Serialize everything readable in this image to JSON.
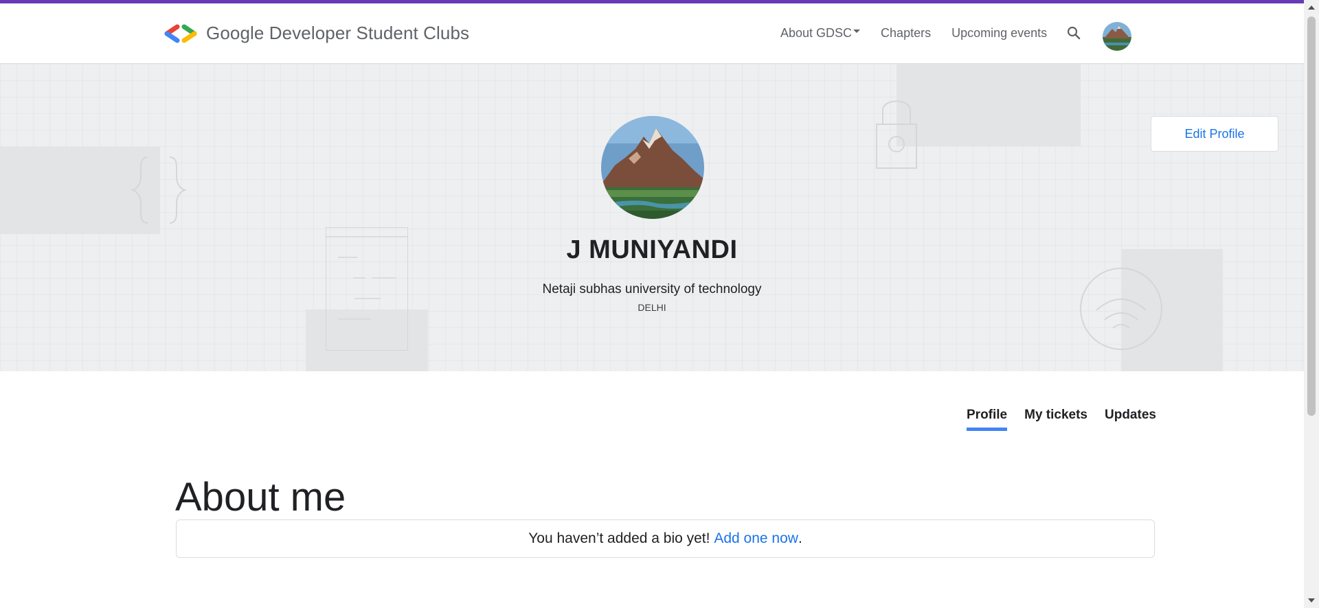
{
  "header": {
    "brand": "Google Developer Student Clubs",
    "nav": {
      "about": "About GDSC",
      "chapters": "Chapters",
      "events": "Upcoming events"
    }
  },
  "profile": {
    "name": "J MUNIYANDI",
    "school": "Netaji subhas university of technology",
    "city": "DELHI",
    "edit_label": "Edit Profile"
  },
  "tabs": {
    "profile": "Profile",
    "tickets": "My tickets",
    "updates": "Updates"
  },
  "about": {
    "title": "About me",
    "bio_text": "You haven’t added a bio yet!",
    "bio_link": "Add one now",
    "bio_end": "."
  },
  "colors": {
    "accent_bar": "#673ab7",
    "link": "#1a73e8",
    "tab_underline": "#4285f4"
  },
  "icons": {
    "logo": "gdsc-logo-icon",
    "search": "search-icon",
    "dropdown": "caret-down-icon"
  }
}
